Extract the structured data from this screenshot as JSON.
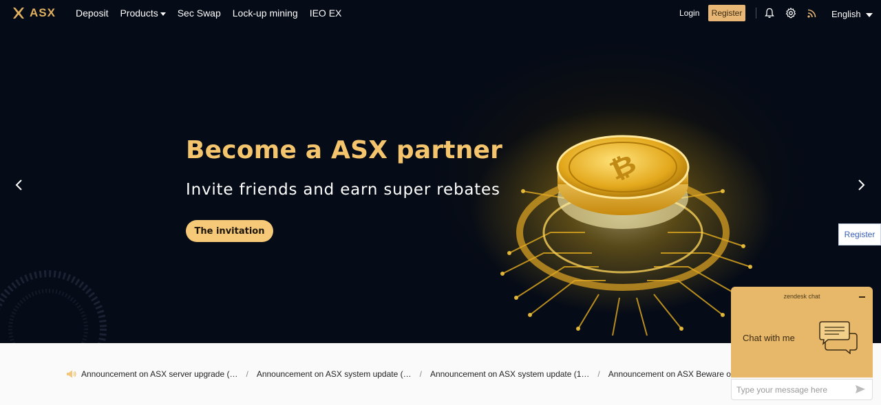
{
  "brand": {
    "name": "ASX",
    "accent": "#e3b260"
  },
  "nav": {
    "items": [
      {
        "label": "Deposit",
        "has_dropdown": false
      },
      {
        "label": "Products",
        "has_dropdown": true
      },
      {
        "label": "Sec Swap",
        "has_dropdown": false
      },
      {
        "label": "Lock-up mining",
        "has_dropdown": false
      },
      {
        "label": "IEO EX",
        "has_dropdown": false
      }
    ],
    "login_label": "Login",
    "register_label": "Register",
    "language": "English",
    "icons": [
      "bell-icon",
      "gear-icon",
      "rss-icon"
    ]
  },
  "hero": {
    "title": "Become a ASX partner",
    "subtitle": "Invite friends and earn super rebates",
    "cta_label": "The invitation"
  },
  "side_register_label": "Register",
  "announcements": [
    "Announcement on ASX server upgrade (…",
    "Announcement on ASX system update (…",
    "Announcement on ASX system update (1…",
    "Announcement on ASX Beware of Fra"
  ],
  "chat": {
    "brand": "zendesk chat",
    "title": "Chat with me",
    "placeholder": "Type your message here"
  }
}
